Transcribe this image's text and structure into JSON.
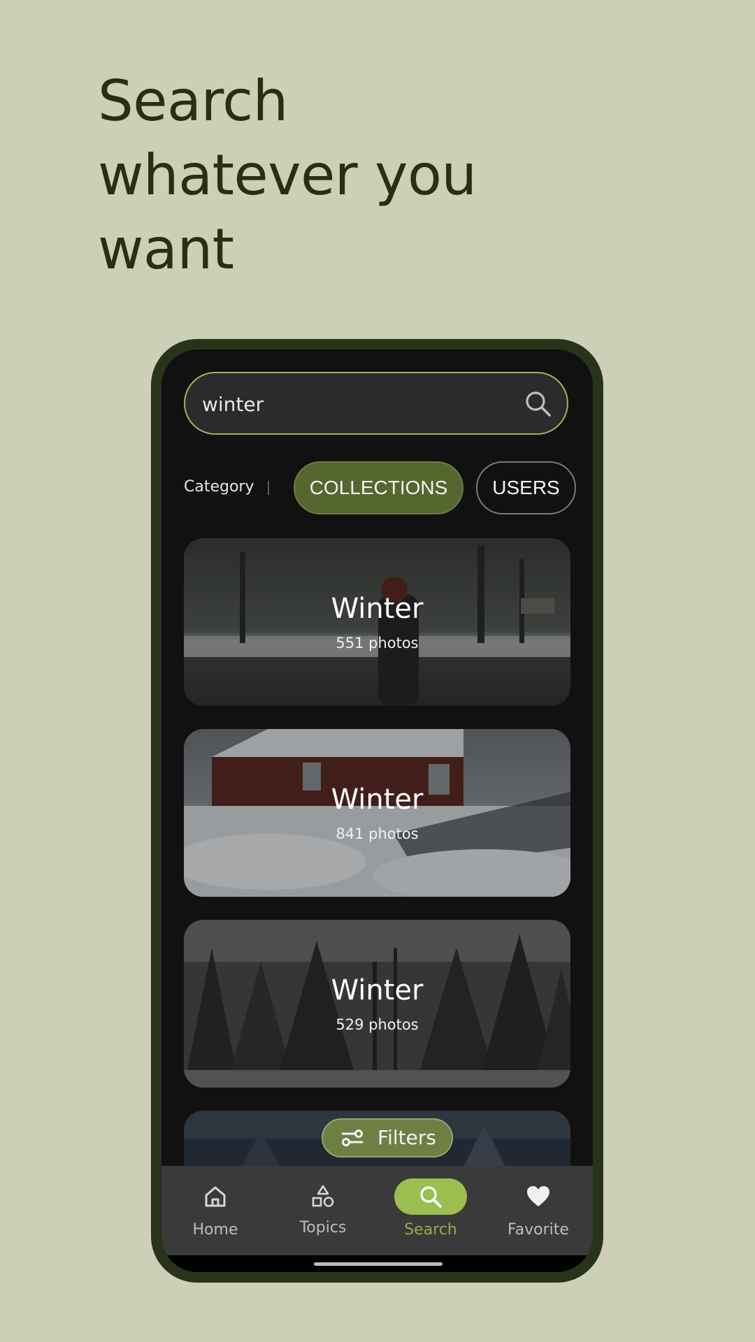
{
  "headline": {
    "line1": "Search",
    "line2": "whatever you",
    "line3": "want"
  },
  "search": {
    "value": "winter"
  },
  "category": {
    "label": "Category",
    "chips": [
      {
        "label": "COLLECTIONS",
        "selected": true
      },
      {
        "label": "USERS",
        "selected": false
      }
    ]
  },
  "collections": [
    {
      "title": "Winter",
      "count": "551 photos"
    },
    {
      "title": "Winter",
      "count": "841 photos"
    },
    {
      "title": "Winter",
      "count": "529 photos"
    }
  ],
  "filters": {
    "label": "Filters",
    "icon": "tune-icon"
  },
  "nav": {
    "items": [
      {
        "label": "Home",
        "icon": "home-icon"
      },
      {
        "label": "Topics",
        "icon": "shapes-icon"
      },
      {
        "label": "Search",
        "icon": "search-icon",
        "active": true
      },
      {
        "label": "Favorite",
        "icon": "heart-icon"
      }
    ]
  },
  "colors": {
    "page_background": "#cdcfb6",
    "headline": "#263015",
    "phone_frame": "#28331a",
    "accent": "#9bbe4f",
    "chip_selected": "#56662f"
  }
}
